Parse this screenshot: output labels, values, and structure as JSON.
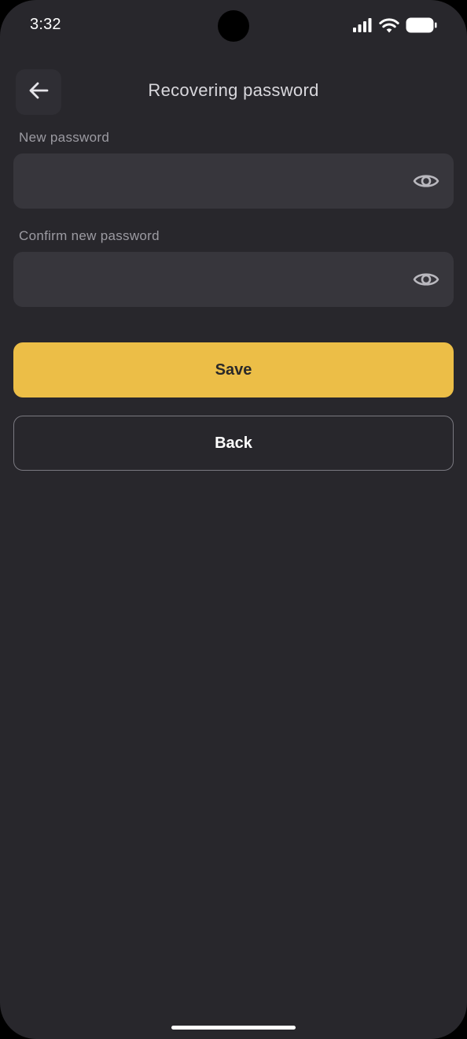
{
  "status_bar": {
    "time": "3:32",
    "icons": [
      "signal-icon",
      "wifi-icon",
      "battery-icon"
    ]
  },
  "header": {
    "title": "Recovering password",
    "back_icon": "arrow-left-icon"
  },
  "form": {
    "new_password": {
      "label": "New password",
      "value": "",
      "placeholder": "",
      "toggle_icon": "eye-icon"
    },
    "confirm_password": {
      "label": "Confirm new password",
      "value": "",
      "placeholder": "",
      "toggle_icon": "eye-icon"
    }
  },
  "actions": {
    "save_label": "Save",
    "back_label": "Back"
  },
  "colors": {
    "background": "#28272c",
    "field_background": "#37363c",
    "accent": "#ecbe47",
    "outline": "#7a7980"
  }
}
